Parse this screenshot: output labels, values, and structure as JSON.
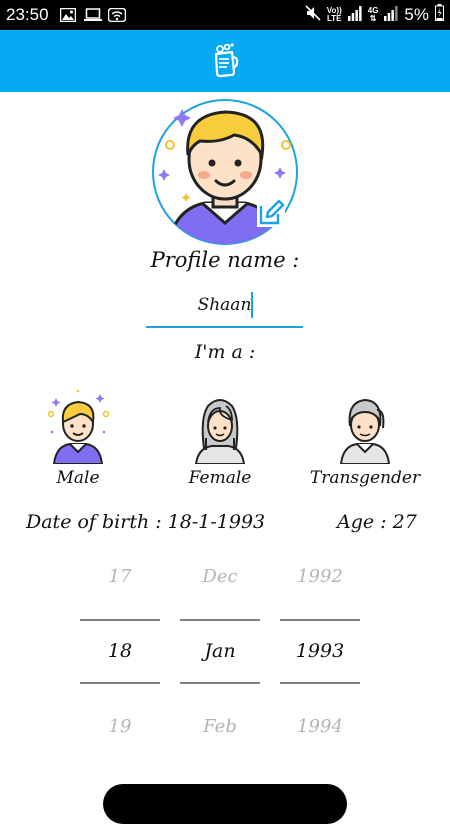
{
  "status_bar": {
    "time": "23:50",
    "volte_top": "Vo))",
    "volte_bottom": "LTE",
    "net_top": "4G",
    "battery": "5%"
  },
  "profile": {
    "name_label": "Profile name :",
    "name_value": "Shaan",
    "iam_label": "I'm a :"
  },
  "genders": [
    {
      "label": "Male"
    },
    {
      "label": "Female"
    },
    {
      "label": "Transgender"
    }
  ],
  "dob": {
    "text": "Date of birth : 18-1-1993",
    "age_text": "Age : 27"
  },
  "picker": {
    "day": {
      "above": "17",
      "selected": "18",
      "below": "19"
    },
    "month": {
      "above": "Dec",
      "selected": "Jan",
      "below": "Feb"
    },
    "year": {
      "above": "1992",
      "selected": "1993",
      "below": "1994"
    }
  },
  "colors": {
    "app_bar": "#05a9f4",
    "accent_underline": "#1ba2e0"
  }
}
